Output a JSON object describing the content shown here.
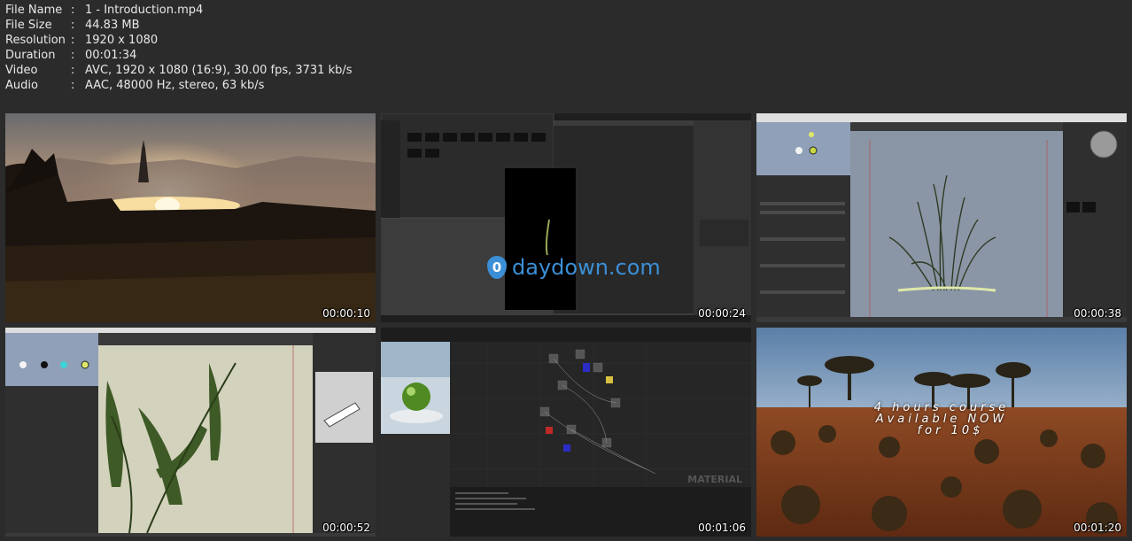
{
  "file_info": [
    {
      "key": "File Name",
      "value": "1 - Introduction.mp4"
    },
    {
      "key": "File Size",
      "value": "44.83 MB"
    },
    {
      "key": "Resolution",
      "value": "1920 x 1080"
    },
    {
      "key": "Duration",
      "value": "00:01:34"
    },
    {
      "key": "Video",
      "value": "AVC, 1920 x 1080 (16:9), 30.00 fps, 3731 kb/s"
    },
    {
      "key": "Audio",
      "value": "AAC, 48000 Hz, stereo, 63 kb/s"
    }
  ],
  "separator": ":",
  "thumbnails": [
    {
      "timestamp": "00:00:10",
      "scene": "sunset-landscape"
    },
    {
      "timestamp": "00:00:24",
      "scene": "editor-dark"
    },
    {
      "timestamp": "00:00:38",
      "scene": "grass-modeler"
    },
    {
      "timestamp": "00:00:52",
      "scene": "plant-editor"
    },
    {
      "timestamp": "00:01:06",
      "scene": "material-graph"
    },
    {
      "timestamp": "00:01:20",
      "scene": "savanna"
    }
  ],
  "watermark": {
    "mark": "0",
    "text": "daydown.com"
  },
  "promo_line1": "4 hours course",
  "promo_line2": "Available NOW",
  "promo_line3": "for 10$",
  "material_label": "MATERIAL",
  "colors": {
    "background": "#2b2b2b",
    "watermark": "#3b8fd6"
  }
}
